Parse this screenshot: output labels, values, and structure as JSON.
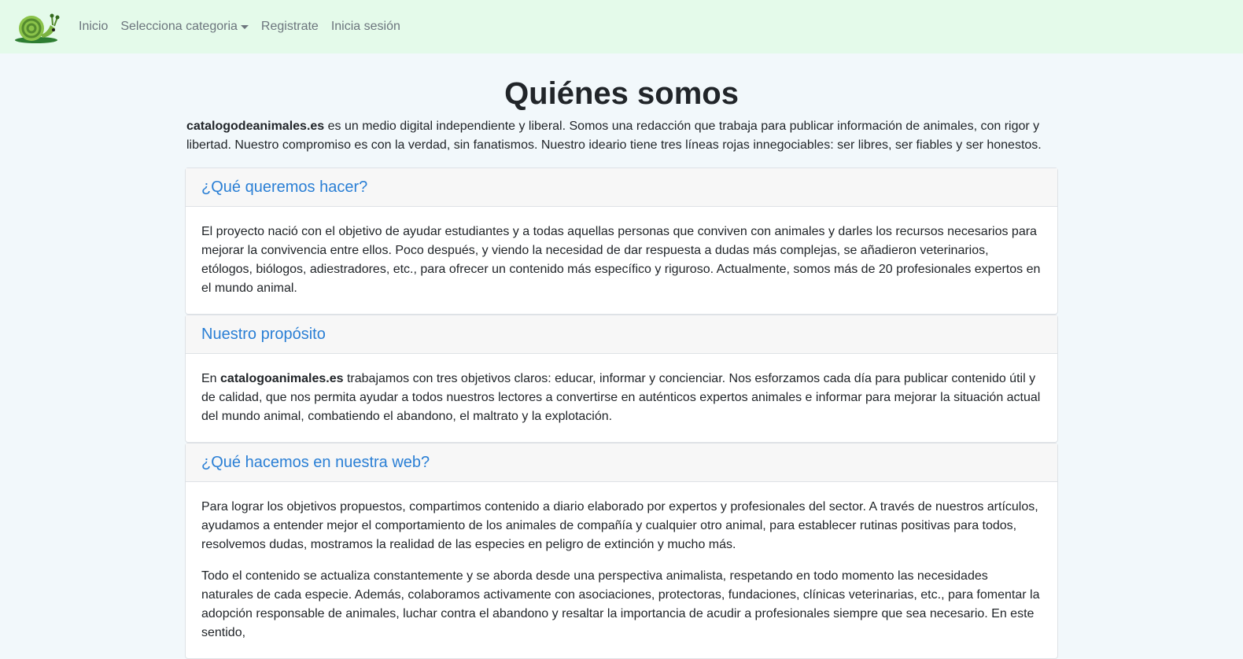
{
  "navbar": {
    "logo_icon": "snail-logo-icon",
    "links": [
      "Inicio",
      "Selecciona categoria",
      "Registrate",
      "Inicia sesión"
    ]
  },
  "page": {
    "title": "Quiénes somos",
    "intro_brand": "catalogodeanimales.es",
    "intro_text": " es un medio digital independiente y liberal. Somos una redacción que trabaja para publicar información de animales, con rigor y libertad. Nuestro compromiso es con la verdad, sin fanatismos. Nuestro ideario tiene tres líneas rojas innegociables: ser libres, ser fiables y ser honestos."
  },
  "sections": [
    {
      "title": "¿Qué queremos hacer?",
      "body": "El proyecto nació con el objetivo de ayudar estudiantes y a todas aquellas personas que conviven con animales y darles los recursos necesarios para mejorar la convivencia entre ellos. Poco después, y viendo la necesidad de dar respuesta a dudas más complejas, se añadieron veterinarios, etólogos, biólogos, adiestradores, etc., para ofrecer un contenido más específico y riguroso. Actualmente, somos más de 20 profesionales expertos en el mundo animal."
    },
    {
      "title": "Nuestro propósito",
      "body_prefix": "En ",
      "body_brand": "catalogoanimales.es",
      "body": " trabajamos con tres objetivos claros: educar, informar y concienciar. Nos esforzamos cada día para publicar contenido útil y de calidad, que nos permita ayudar a todos nuestros lectores a convertirse en auténticos expertos animales e informar para mejorar la situación actual del mundo animal, combatiendo el abandono, el maltrato y la explotación."
    },
    {
      "title": "¿Qué hacemos en nuestra web?",
      "body": "Para lograr los objetivos propuestos, compartimos contenido a diario elaborado por expertos y profesionales del sector. A través de nuestros artículos, ayudamos a entender mejor el comportamiento de los animales de compañía y cualquier otro animal, para establecer rutinas positivas para todos, resolvemos dudas, mostramos la realidad de las especies en peligro de extinción y mucho más.",
      "body2": "Todo el contenido se actualiza constantemente y se aborda desde una perspectiva animalista, respetando en todo momento las necesidades naturales de cada especie. Además, colaboramos activamente con asociaciones, protectoras, fundaciones, clínicas veterinarias, etc., para fomentar la adopción responsable de animales, luchar contra el abandono y resaltar la importancia de acudir a profesionales siempre que sea necesario. En este sentido,"
    }
  ]
}
